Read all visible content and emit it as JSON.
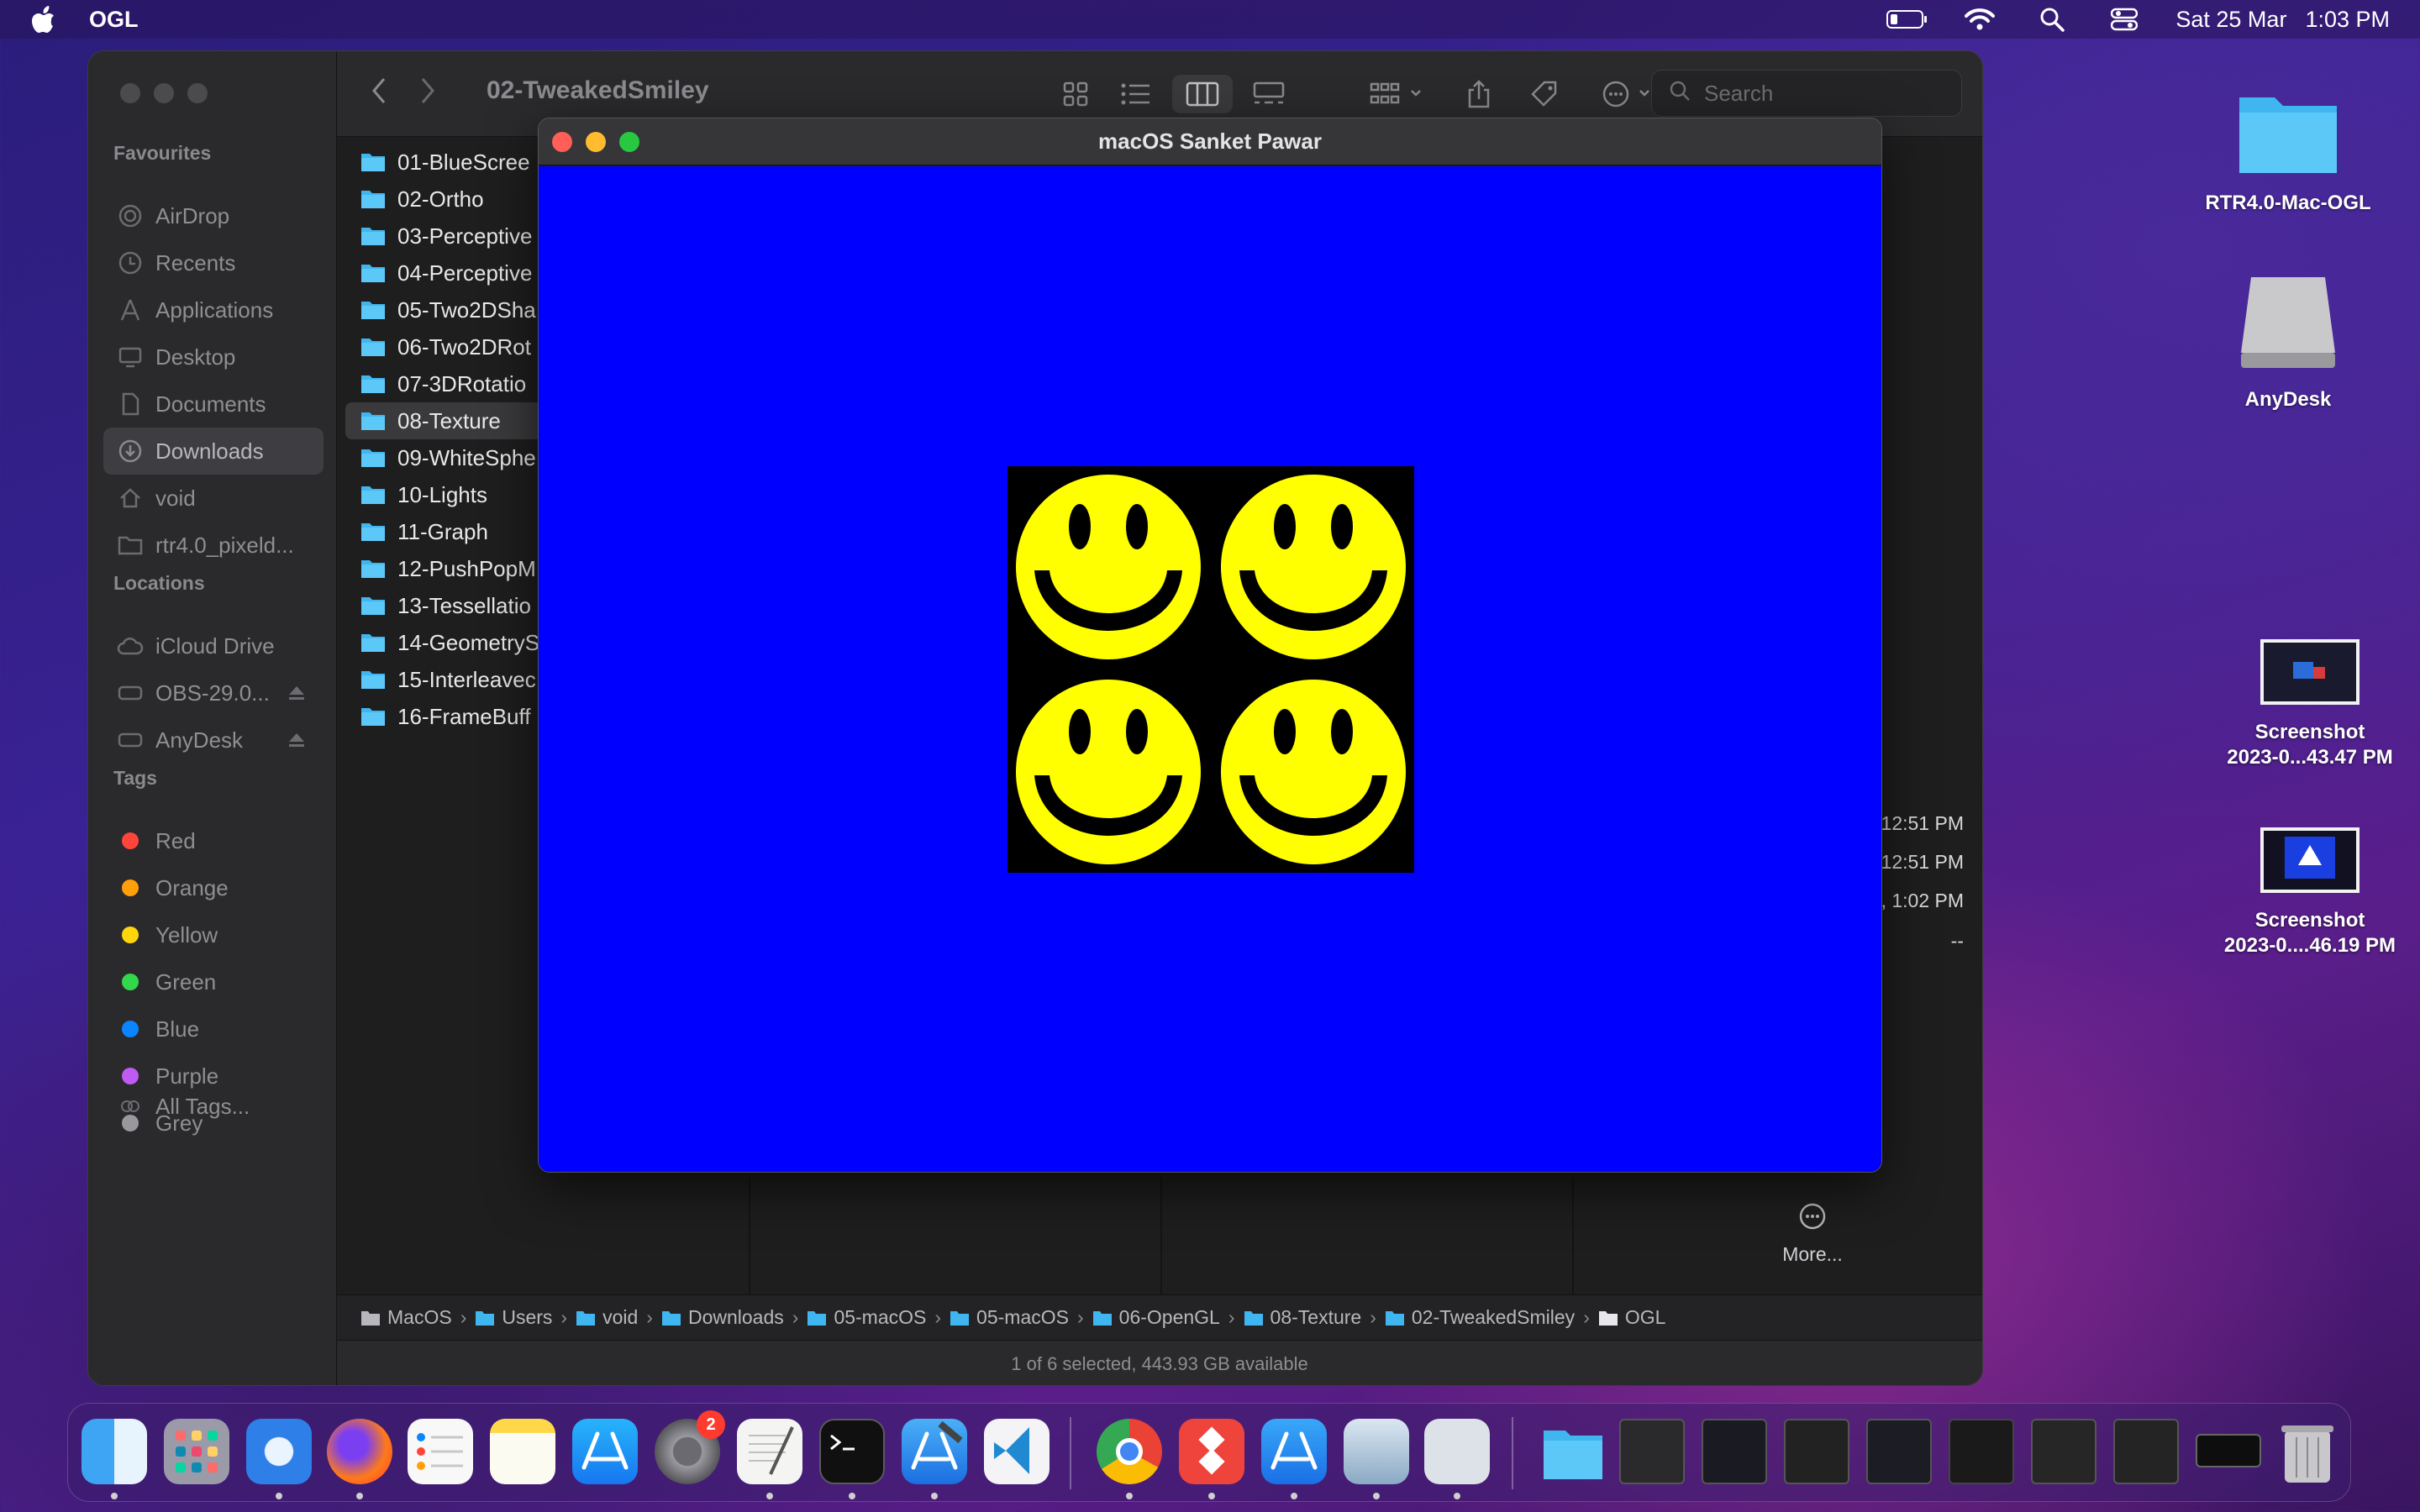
{
  "menubar": {
    "app_name": "OGL",
    "date": "Sat 25 Mar",
    "time": "1:03 PM"
  },
  "finder": {
    "title": "02-TweakedSmiley",
    "search_placeholder": "Search",
    "sidebar": {
      "favourites_heading": "Favourites",
      "favourites": [
        "AirDrop",
        "Recents",
        "Applications",
        "Desktop",
        "Documents",
        "Downloads",
        "void",
        "rtr4.0_pixeld..."
      ],
      "selected": "Downloads",
      "locations_heading": "Locations",
      "locations": [
        "iCloud Drive",
        "OBS-29.0...",
        "AnyDesk"
      ],
      "tags_heading": "Tags",
      "tags": [
        {
          "name": "Red",
          "color": "#ff453a"
        },
        {
          "name": "Orange",
          "color": "#ff9f0a"
        },
        {
          "name": "Yellow",
          "color": "#ffd60a"
        },
        {
          "name": "Green",
          "color": "#32d74b"
        },
        {
          "name": "Blue",
          "color": "#0a84ff"
        },
        {
          "name": "Purple",
          "color": "#bf5af2"
        },
        {
          "name": "Grey",
          "color": "#98989d"
        }
      ],
      "all_tags": "All Tags..."
    },
    "files": [
      "01-BlueScree",
      "02-Ortho",
      "03-Perceptive",
      "04-Perceptive",
      "05-Two2DSha",
      "06-Two2DRot",
      "07-3DRotatio",
      "08-Texture",
      "09-WhiteSphe",
      "10-Lights",
      "11-Graph",
      "12-PushPopM",
      "13-Tessellatio",
      "14-GeometryS",
      "15-Interleavec",
      "16-FrameBuff"
    ],
    "selected_file": "08-Texture",
    "meta": [
      "12:51 PM",
      "12:51 PM",
      ", 1:02 PM",
      "--"
    ],
    "more_label": "More...",
    "path": [
      "MacOS",
      "Users",
      "void",
      "Downloads",
      "05-macOS",
      "05-macOS",
      "06-OpenGL",
      "08-Texture",
      "02-TweakedSmiley",
      "OGL"
    ],
    "status": "1 of 6 selected, 443.93 GB available"
  },
  "gl_window": {
    "title": "macOS Sanket Pawar",
    "clear_color": "#0000ff",
    "smiley_color": "#ffff00"
  },
  "desktop": [
    {
      "name": "RTR4.0-Mac-OGL",
      "icon": "folder-icon"
    },
    {
      "name": "AnyDesk",
      "icon": "drive-icon"
    },
    {
      "name": "Screenshot\n2023-0...43.47 PM",
      "line1": "Screenshot",
      "line2": "2023-0...43.47 PM",
      "icon": "screenshot-icon"
    },
    {
      "name": "Screenshot\n2023-0....46.19 PM",
      "line1": "Screenshot",
      "line2": "2023-0....46.19 PM",
      "icon": "screenshot-icon"
    }
  ],
  "dock": {
    "badge_count": "2",
    "apps": [
      "finder",
      "launchpad",
      "safari",
      "firefox",
      "reminders",
      "notes",
      "app-store",
      "system-preferences",
      "textedit",
      "terminal",
      "xcode",
      "vscode",
      "chrome",
      "anydesk",
      "xcode-instruments",
      "preview",
      "ogl"
    ]
  }
}
